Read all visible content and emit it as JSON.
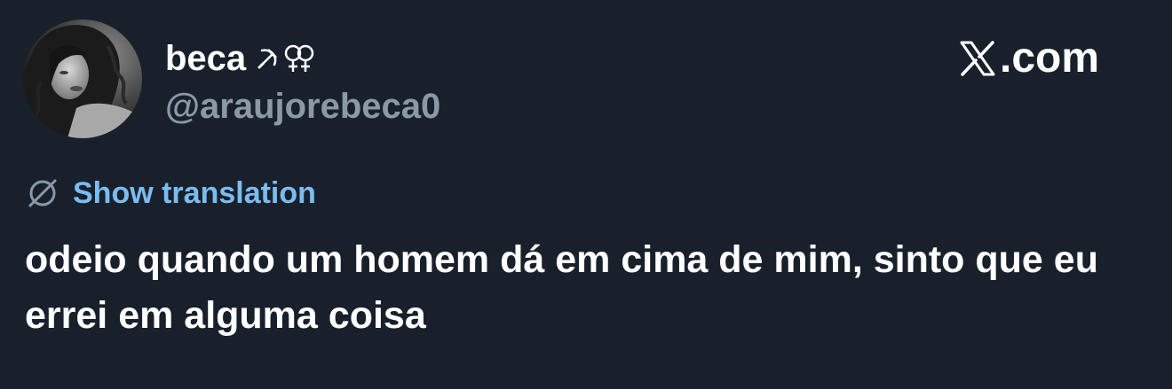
{
  "tweet": {
    "display_name": "beca",
    "name_emojis": [
      "hammer-and-sickle",
      "doubled-female-sign"
    ],
    "handle": "@araujorebeca0",
    "translate_label": "Show translation",
    "text": "odeio quando um homem dá em cima de mim, sinto que eu errei em alguma coisa"
  },
  "brand": {
    "site": "X.com",
    "domain_text": ".com"
  },
  "colors": {
    "background": "#18202c",
    "text_primary": "#ffffff",
    "text_secondary": "#8b98a5",
    "link": "#7cbcef"
  },
  "icons": {
    "avatar": "profile-photo",
    "translate": "globe-slash-icon",
    "logo": "x-logo-icon"
  }
}
